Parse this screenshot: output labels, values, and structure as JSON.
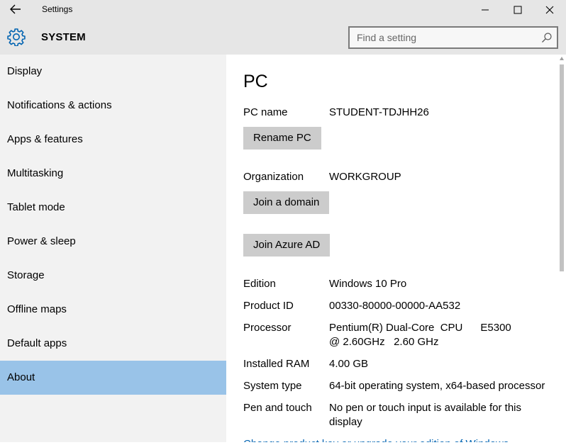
{
  "window": {
    "title": "Settings",
    "icons": [
      "back-arrow-icon",
      "minimize-icon",
      "maximize-icon",
      "close-icon"
    ]
  },
  "header": {
    "section": "SYSTEM",
    "search_placeholder": "Find a setting",
    "icons": [
      "gear-icon",
      "search-icon"
    ]
  },
  "sidebar": {
    "items": [
      {
        "label": "Display"
      },
      {
        "label": "Notifications & actions"
      },
      {
        "label": "Apps & features"
      },
      {
        "label": "Multitasking"
      },
      {
        "label": "Tablet mode"
      },
      {
        "label": "Power & sleep"
      },
      {
        "label": "Storage"
      },
      {
        "label": "Offline maps"
      },
      {
        "label": "Default apps"
      },
      {
        "label": "About",
        "selected": true
      }
    ]
  },
  "main": {
    "heading": "PC",
    "pc_name_label": "PC name",
    "pc_name_value": "STUDENT-TDJHH26",
    "rename_button": "Rename PC",
    "organization_label": "Organization",
    "organization_value": "WORKGROUP",
    "join_domain_button": "Join a domain",
    "join_azure_button": "Join Azure AD",
    "specs": [
      {
        "label": "Edition",
        "value": "Windows 10 Pro"
      },
      {
        "label": "Product ID",
        "value": "00330-80000-00000-AA532"
      },
      {
        "label": "Processor",
        "value": "Pentium(R) Dual-Core  CPU      E5300  @ 2.60GHz   2.60 GHz"
      },
      {
        "label": "Installed RAM",
        "value": "4.00 GB"
      },
      {
        "label": "System type",
        "value": "64-bit operating system, x64-based processor"
      },
      {
        "label": "Pen and touch",
        "value": "No pen or touch input is available for this display"
      }
    ],
    "change_key_link": "Change product key or upgrade your edition of Windows"
  },
  "colors": {
    "selected_nav": "#99c3e8",
    "accent": "#0063b1",
    "button": "#cccccc"
  }
}
